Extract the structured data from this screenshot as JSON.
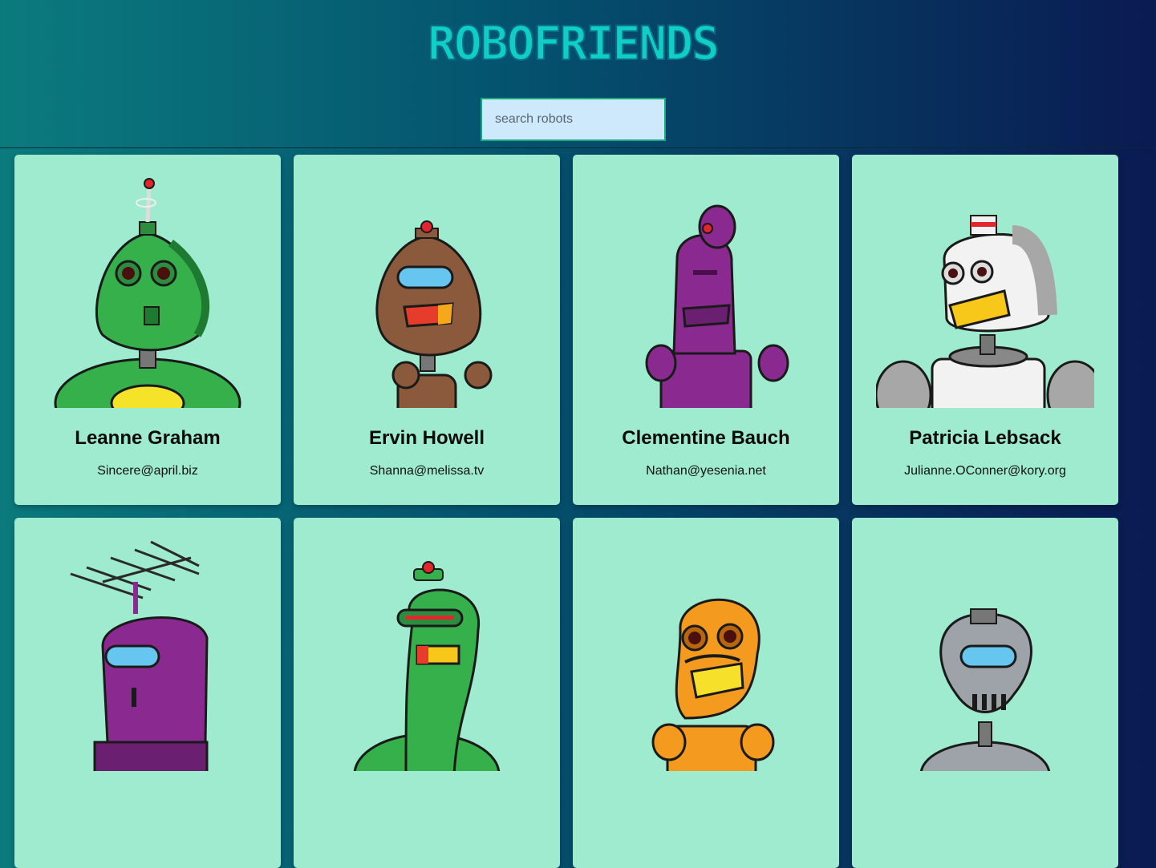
{
  "app": {
    "title": "ROBOFRIENDS"
  },
  "search": {
    "placeholder": "search robots",
    "value": ""
  },
  "robots": [
    {
      "name": "Leanne Graham",
      "email": "Sincere@april.biz",
      "color": "#35b04a",
      "accent": "#1f7a31"
    },
    {
      "name": "Ervin Howell",
      "email": "Shanna@melissa.tv",
      "color": "#8b5a3c",
      "accent": "#5c3824"
    },
    {
      "name": "Clementine Bauch",
      "email": "Nathan@yesenia.net",
      "color": "#8a2a91",
      "accent": "#5b1a61"
    },
    {
      "name": "Patricia Lebsack",
      "email": "Julianne.OConner@kory.org",
      "color": "#f2f2f2",
      "accent": "#a7a7a7"
    },
    {
      "name": "",
      "email": "",
      "color": "#8a2a91",
      "accent": "#5b1a61"
    },
    {
      "name": "",
      "email": "",
      "color": "#35b04a",
      "accent": "#1f7a31"
    },
    {
      "name": "",
      "email": "",
      "color": "#f39a1f",
      "accent": "#b8660a"
    },
    {
      "name": "",
      "email": "",
      "color": "#9da3a8",
      "accent": "#6a7076"
    }
  ]
}
